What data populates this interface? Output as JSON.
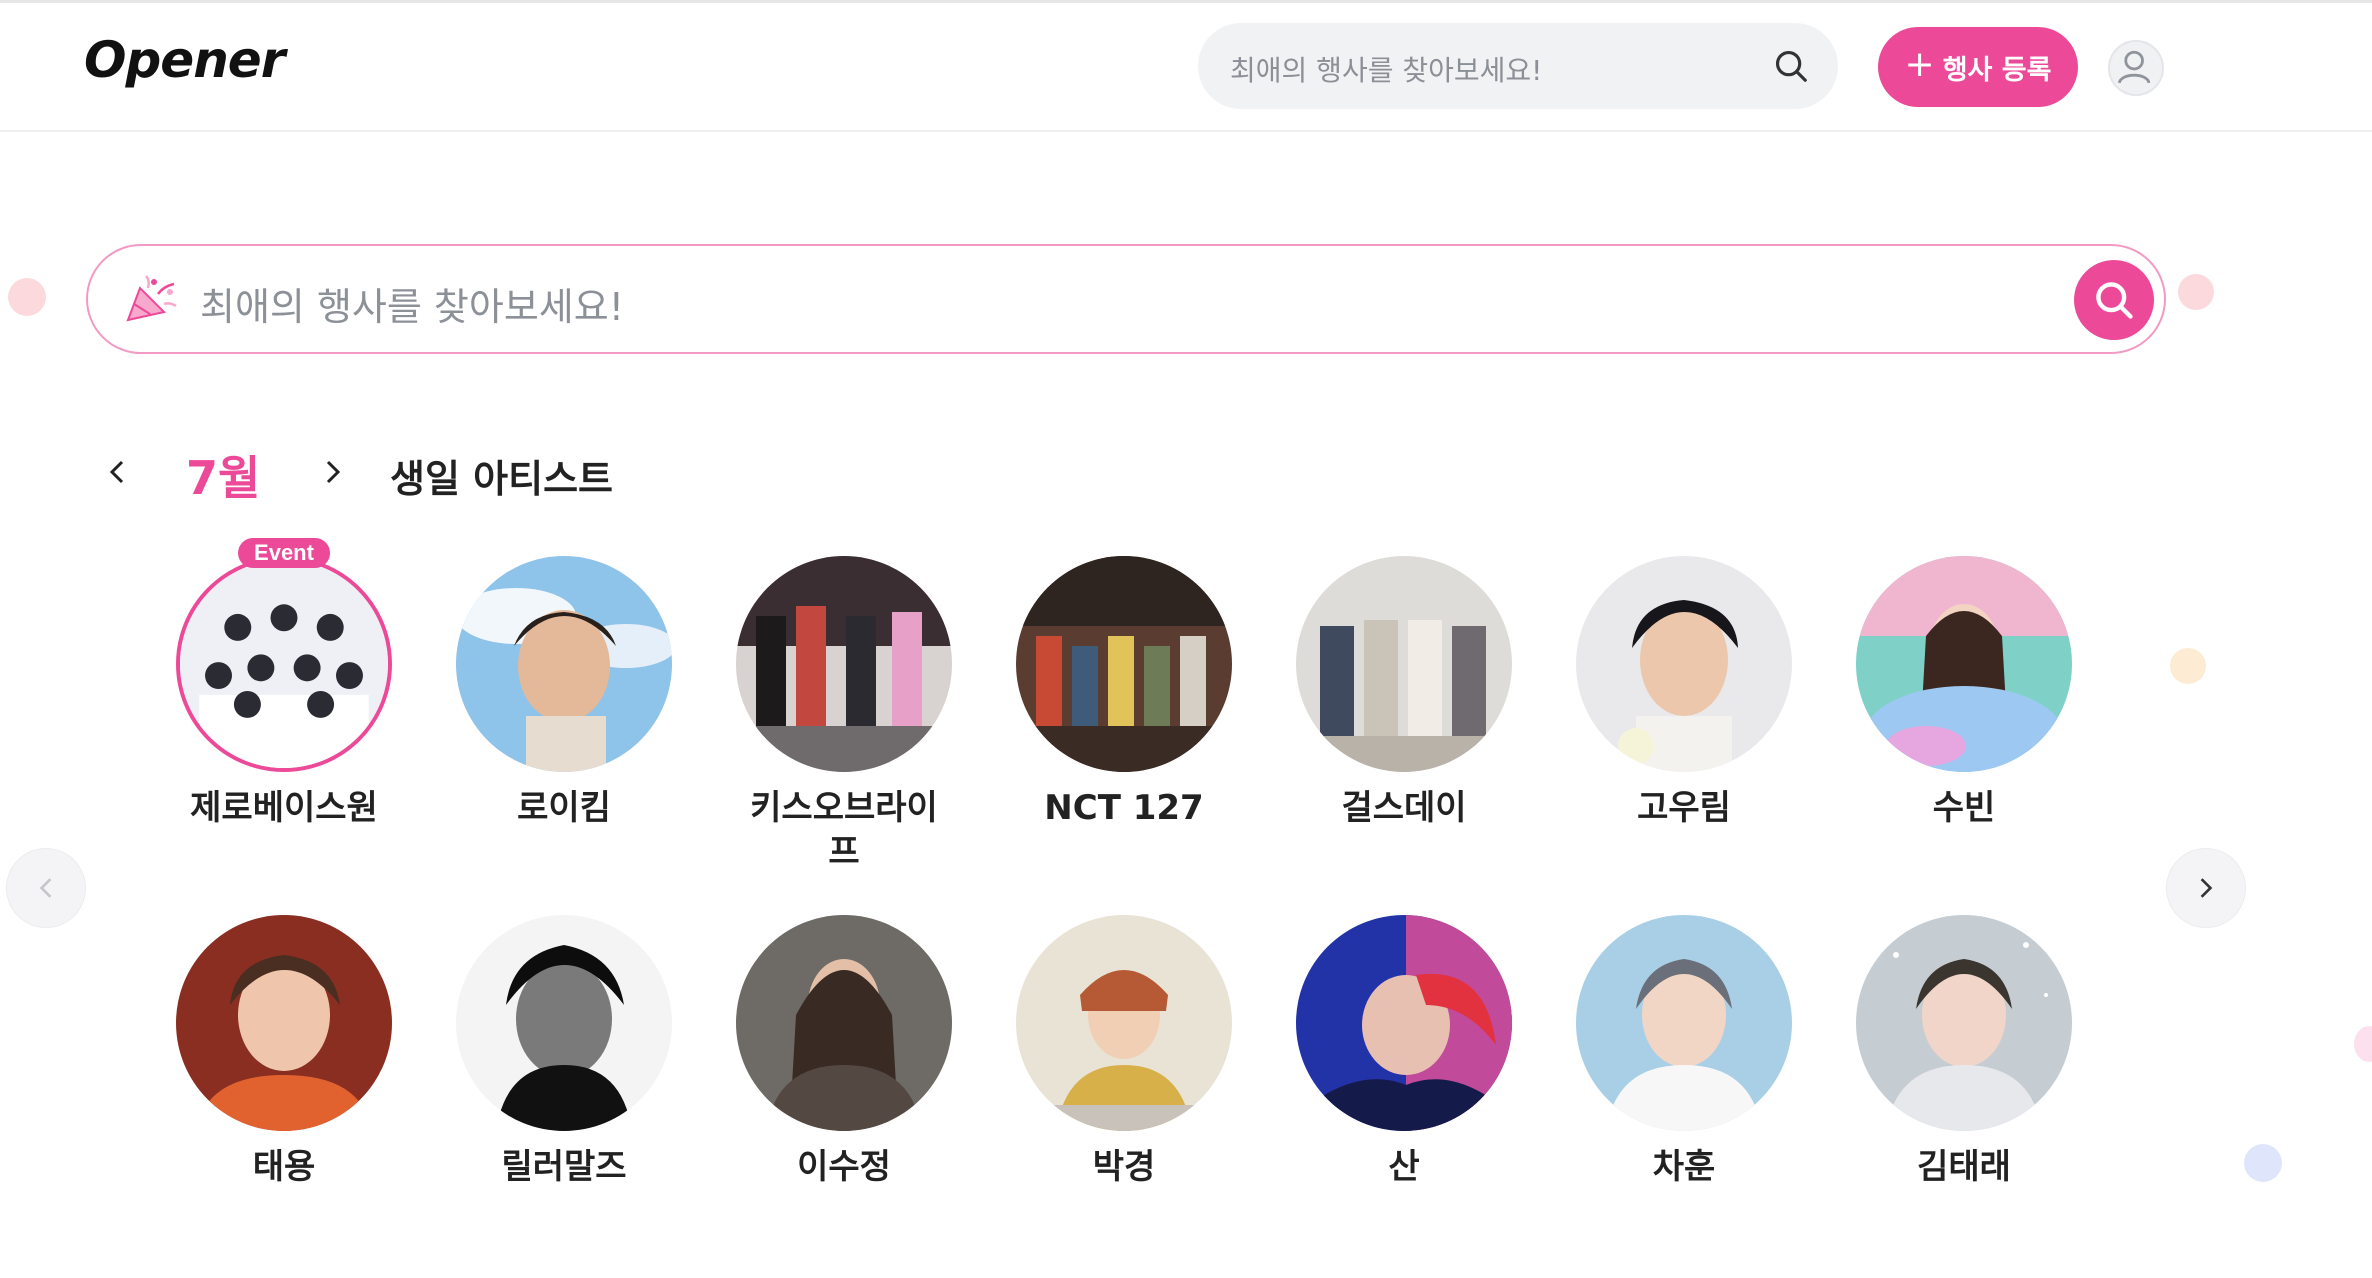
{
  "header": {
    "logo": "Opener",
    "search_placeholder": "최애의 행사를 찾아보세요!",
    "add_event_label": "행사 등록",
    "add_event_icon": "plus-icon",
    "profile_icon": "user-icon"
  },
  "hero_search": {
    "placeholder": "최애의 행사를 찾아보세요!",
    "leading_icon": "party-popper-icon",
    "button_icon": "search-icon"
  },
  "birthday_section": {
    "month": "7월",
    "title": "생일 아티스트",
    "prev_icon": "chevron-left-icon",
    "next_icon": "chevron-right-icon"
  },
  "artists": [
    {
      "name": "제로베이스원",
      "badge": "Event"
    },
    {
      "name": "로이킴"
    },
    {
      "name": "키스오브라이프"
    },
    {
      "name": "NCT 127"
    },
    {
      "name": "걸스데이"
    },
    {
      "name": "고우림"
    },
    {
      "name": "수빈"
    },
    {
      "name": "태용"
    },
    {
      "name": "릴러말즈"
    },
    {
      "name": "이수정"
    },
    {
      "name": "박경"
    },
    {
      "name": "산"
    },
    {
      "name": "차훈"
    },
    {
      "name": "김태래"
    }
  ],
  "colors": {
    "accent": "#ec4a98",
    "search_bg": "#f1f2f4",
    "text": "#222222",
    "muted": "#8c9097"
  }
}
